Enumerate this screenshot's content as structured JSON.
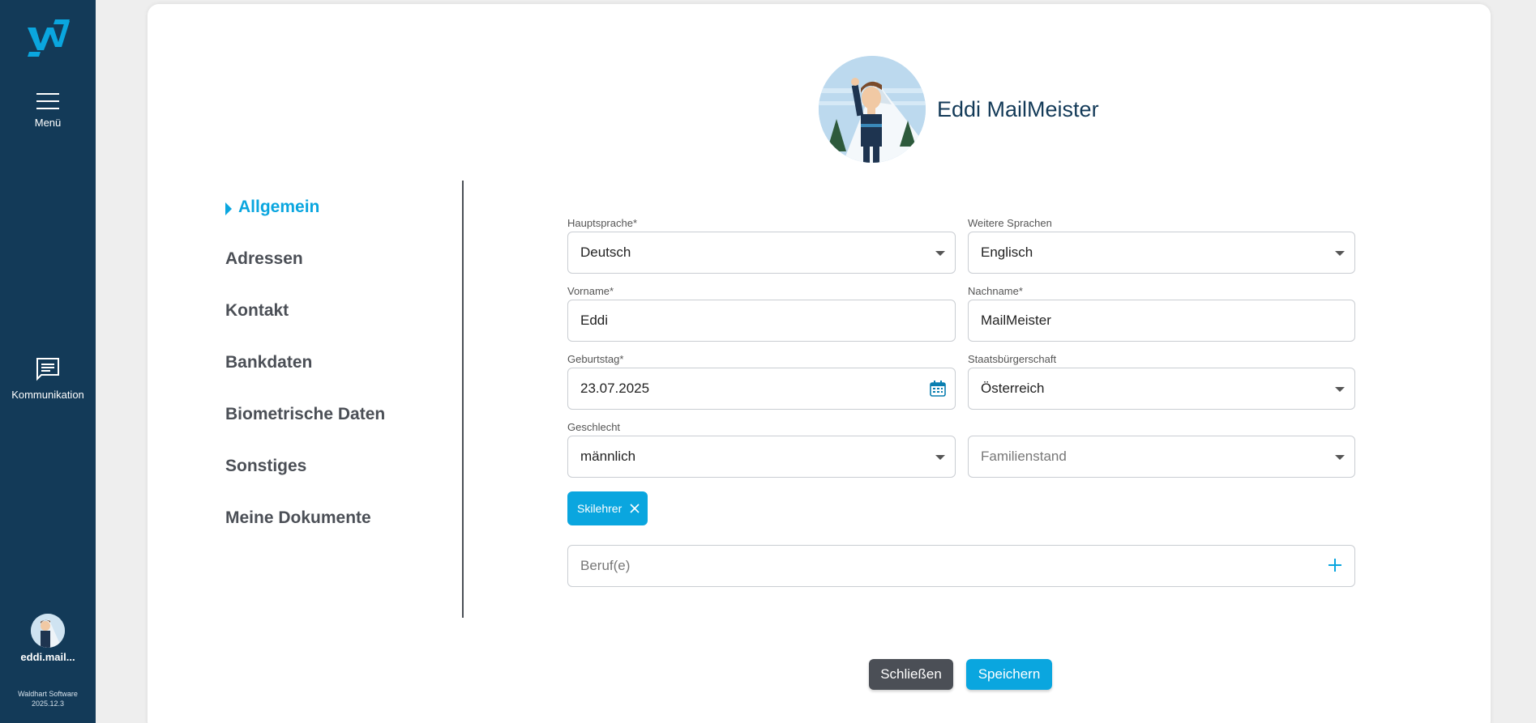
{
  "sidebar": {
    "menu_label": "Menü",
    "communication_label": "Kommunikation",
    "user_label": "eddi.mail...",
    "footer_company": "Waldhart Software",
    "footer_version": "2025.12.3"
  },
  "profile": {
    "name": "Eddi MailMeister"
  },
  "nav": {
    "items": [
      {
        "label": "Allgemein",
        "active": true
      },
      {
        "label": "Adressen"
      },
      {
        "label": "Kontakt"
      },
      {
        "label": "Bankdaten"
      },
      {
        "label": "Biometrische Daten"
      },
      {
        "label": "Sonstiges"
      },
      {
        "label": "Meine Dokumente"
      }
    ]
  },
  "form": {
    "hauptsprache": {
      "label": "Hauptsprache*",
      "value": "Deutsch"
    },
    "weitere_sprachen": {
      "label": "Weitere Sprachen",
      "value": "Englisch"
    },
    "vorname": {
      "label": "Vorname*",
      "value": "Eddi"
    },
    "nachname": {
      "label": "Nachname*",
      "value": "MailMeister"
    },
    "geburtstag": {
      "label": "Geburtstag*",
      "value": "23.07.2025"
    },
    "staatsbuergerschaft": {
      "label": "Staatsbürgerschaft",
      "value": "Österreich"
    },
    "geschlecht": {
      "label": "Geschlecht",
      "value": "männlich"
    },
    "familienstand": {
      "placeholder": "Familienstand"
    },
    "chip": "Skilehrer",
    "berufe": {
      "placeholder": "Beruf(e)"
    }
  },
  "buttons": {
    "close": "Schließen",
    "save": "Speichern"
  },
  "colors": {
    "sidebar": "#133a58",
    "accent": "#0aa6df",
    "dark_button": "#4b4f56"
  }
}
